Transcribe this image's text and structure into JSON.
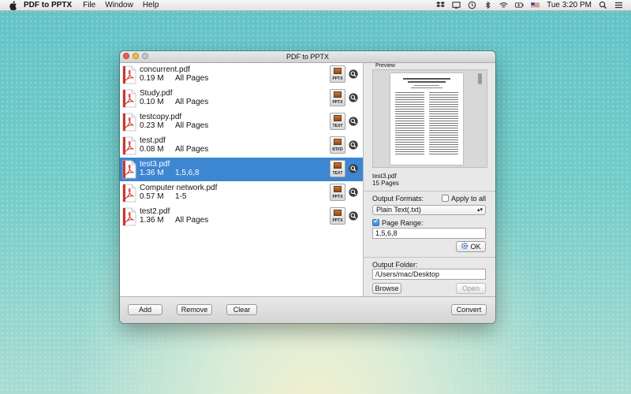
{
  "menubar": {
    "app_name": "PDF to PPTX",
    "menus": [
      "File",
      "Window",
      "Help"
    ],
    "clock": "Tue 3:20 PM"
  },
  "window": {
    "title": "PDF to PPTX"
  },
  "files": [
    {
      "name": "concurrent.pdf",
      "size": "0.19 M",
      "range": "All Pages",
      "format": "PPTX"
    },
    {
      "name": "Study.pdf",
      "size": "0.10 M",
      "range": "All Pages",
      "format": "PPTX"
    },
    {
      "name": "testcopy.pdf",
      "size": "0.23 M",
      "range": "All Pages",
      "format": "TEXT"
    },
    {
      "name": "test.pdf",
      "size": "0.08 M",
      "range": "All Pages",
      "format": "RTFD"
    },
    {
      "name": "test3.pdf",
      "size": "1.36 M",
      "range": "1,5,6,8",
      "format": "TEXT"
    },
    {
      "name": "Computer network.pdf",
      "size": "0.57 M",
      "range": "1-5",
      "format": "PPTX"
    },
    {
      "name": "test2.pdf",
      "size": "1.36 M",
      "range": "All Pages",
      "format": "PPTX"
    }
  ],
  "selected_index": 4,
  "preview": {
    "label": "Preview",
    "filename": "test3.pdf",
    "pages": "15 Pages"
  },
  "output": {
    "formats_label": "Output Formats:",
    "apply_all_label": "Apply to all",
    "apply_all_checked": false,
    "format_selected": "Plain Text(.txt)",
    "page_range_label": "Page Range:",
    "page_range_checked": true,
    "page_range_value": "1,5,6,8",
    "ok_label": "OK",
    "folder_label": "Output Folder:",
    "folder_value": "/Users/mac/Desktop",
    "browse_label": "Browse",
    "open_label": "Open"
  },
  "bottom": {
    "add_label": "Add",
    "remove_label": "Remove",
    "clear_label": "Clear",
    "convert_label": "Convert"
  },
  "colors": {
    "selection": "#3d86d1",
    "pdf_red": "#d0342c",
    "background": "#6cc7c8"
  }
}
